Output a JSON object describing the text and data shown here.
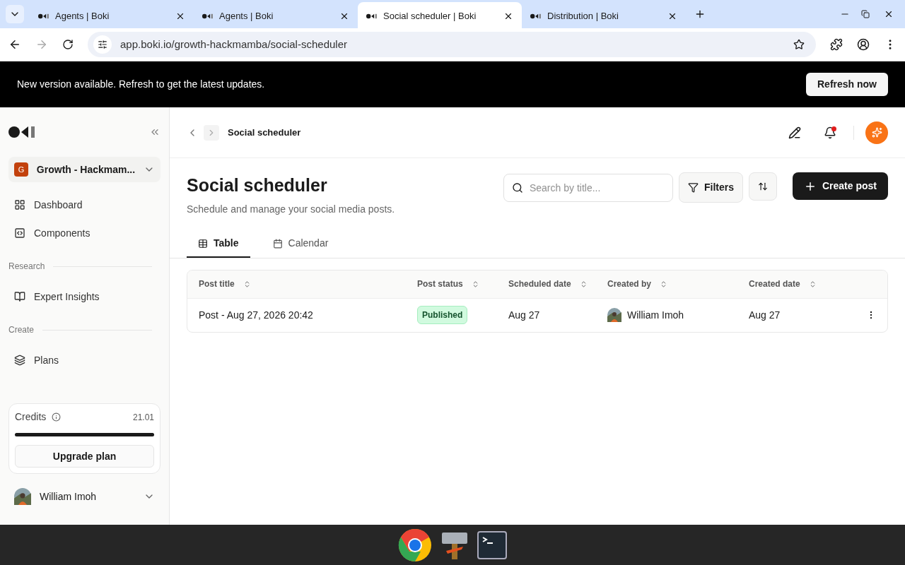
{
  "browser": {
    "tabs": [
      {
        "title": "Agents | Boki",
        "selected": false
      },
      {
        "title": "Agents | Boki",
        "selected": false
      },
      {
        "title": "Social scheduler | Boki",
        "selected": true
      },
      {
        "title": "Distribution | Boki",
        "selected": false
      }
    ],
    "url": "app.boki.io/growth-hackmamba/social-scheduler"
  },
  "banner": {
    "message": "New version available. Refresh to get the latest updates.",
    "button": "Refresh now"
  },
  "sidebar": {
    "workspace": {
      "initial": "G",
      "name": "Growth - Hackmam..."
    },
    "items": [
      {
        "kind": "item",
        "label": "Dashboard"
      },
      {
        "kind": "item",
        "label": "Components"
      },
      {
        "kind": "section",
        "label": "Research"
      },
      {
        "kind": "item",
        "label": "Expert Insights"
      },
      {
        "kind": "section",
        "label": "Create"
      },
      {
        "kind": "item",
        "label": "Plans"
      }
    ],
    "credits": {
      "label": "Credits",
      "value": "21.01",
      "level": 1,
      "button": "Upgrade plan"
    },
    "user": "William Imoh"
  },
  "header": {
    "breadcrumb": "Social scheduler"
  },
  "page": {
    "title": "Social scheduler",
    "subtitle": "Schedule and manage your social media posts.",
    "search": {
      "placeholder": "Search by title..."
    },
    "filters": "Filters",
    "create": "Create post",
    "tabs": [
      {
        "label": "Table",
        "selected": true
      },
      {
        "label": "Calendar",
        "selected": false
      }
    ]
  },
  "table": {
    "columns": [
      "Post title",
      "Post status",
      "Scheduled date",
      "Created by",
      "Created date"
    ],
    "rows": [
      {
        "title": "Post - Aug 27, 2026 20:42",
        "status": "Published",
        "scheduled": "Aug 27",
        "created_by": "William Imoh",
        "created": "Aug 27"
      }
    ]
  }
}
